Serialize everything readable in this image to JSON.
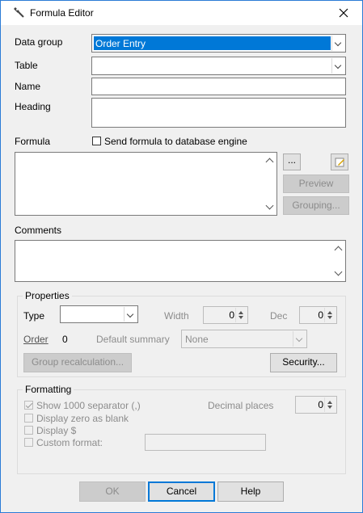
{
  "window": {
    "title": "Formula Editor"
  },
  "fields": {
    "data_group_label": "Data group",
    "data_group_value": "Order Entry",
    "table_label": "Table",
    "name_label": "Name",
    "heading_label": "Heading",
    "formula_label": "Formula",
    "send_formula_label": "Send formula to database engine",
    "ellipsis_label": "...",
    "preview_label": "Preview",
    "grouping_label": "Grouping...",
    "comments_label": "Comments"
  },
  "properties": {
    "title": "Properties",
    "type_label": "Type",
    "width_label": "Width",
    "width_value": "0",
    "dec_label": "Dec",
    "dec_value": "0",
    "order_label": "Order",
    "order_value": "0",
    "default_summary_label": "Default summary",
    "default_summary_value": "None",
    "group_recalc_label": "Group recalculation...",
    "security_label": "Security..."
  },
  "formatting": {
    "title": "Formatting",
    "show_1000_label": "Show 1000 separator (,)",
    "show_1000_checked": true,
    "display_zero_label": "Display zero as blank",
    "display_dollar_label": "Display $",
    "custom_format_label": "Custom format:",
    "decimal_places_label": "Decimal places",
    "decimal_places_value": "0"
  },
  "footer": {
    "ok_label": "OK",
    "cancel_label": "Cancel",
    "help_label": "Help"
  }
}
